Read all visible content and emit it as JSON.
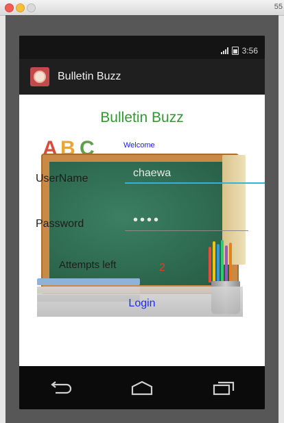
{
  "window": {
    "title_fragment": "55"
  },
  "status_bar": {
    "time": "3:56"
  },
  "action_bar": {
    "title": "Bulletin Buzz"
  },
  "main": {
    "heading": "Bulletin Buzz",
    "welcome": "Welcome",
    "username_label": "UserName",
    "username_value": "chaewa",
    "password_label": "Password",
    "password_value": "••••",
    "attempts_label": "Attempts left",
    "attempts_value": "2",
    "login_label": "Login"
  },
  "nav": {
    "back_icon": "back-icon",
    "home_icon": "home-icon",
    "recents_icon": "recents-icon"
  },
  "colors": {
    "heading_green": "#2f9a2f",
    "welcome_blue": "#1a1aff",
    "attempts_red": "#e23a2a",
    "login_blue": "#1c2cf0",
    "field_focus": "#39b0d6"
  }
}
